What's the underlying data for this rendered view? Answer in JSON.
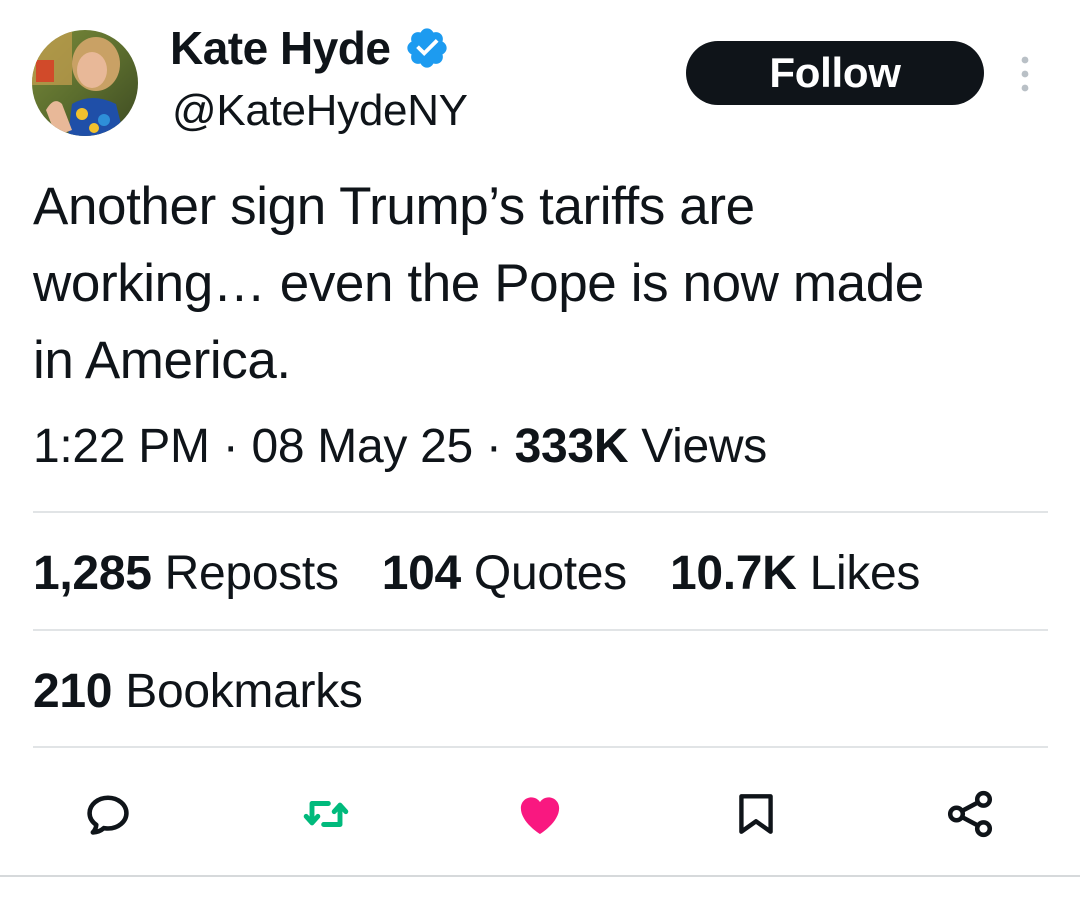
{
  "author": {
    "name": "Kate Hyde",
    "handle": "@KateHydeNY",
    "verified_icon": "verified-badge-icon",
    "avatar": "profile-photo"
  },
  "header": {
    "follow_label": "Follow",
    "more_icon": "more-options-icon"
  },
  "tweet": {
    "text": "Another sign Trump’s tariffs are\nworking… even the Pope is now made\nin America.",
    "time": "1:22 PM",
    "date": "08 May 25",
    "separator": " · ",
    "views_count": "333K",
    "views_label": " Views"
  },
  "stats": {
    "reposts": {
      "count": "1,285",
      "label": " Reposts"
    },
    "quotes": {
      "count": "104",
      "label": " Quotes"
    },
    "likes": {
      "count": "10.7K",
      "label": " Likes"
    },
    "bookmarks": {
      "count": "210",
      "label": " Bookmarks"
    }
  },
  "actions": {
    "reply_icon": "reply-icon",
    "repost_icon": "repost-icon",
    "like_icon": "like-heart-icon",
    "bookmark_icon": "bookmark-icon",
    "share_icon": "share-icon"
  },
  "colors": {
    "text": "#0f1419",
    "verified": "#1d9bf0",
    "repost": "#00ba7c",
    "like": "#f91880",
    "icon_gray": "#536471",
    "follow_bg": "#0f1419",
    "divider": "#e1e4e6"
  }
}
